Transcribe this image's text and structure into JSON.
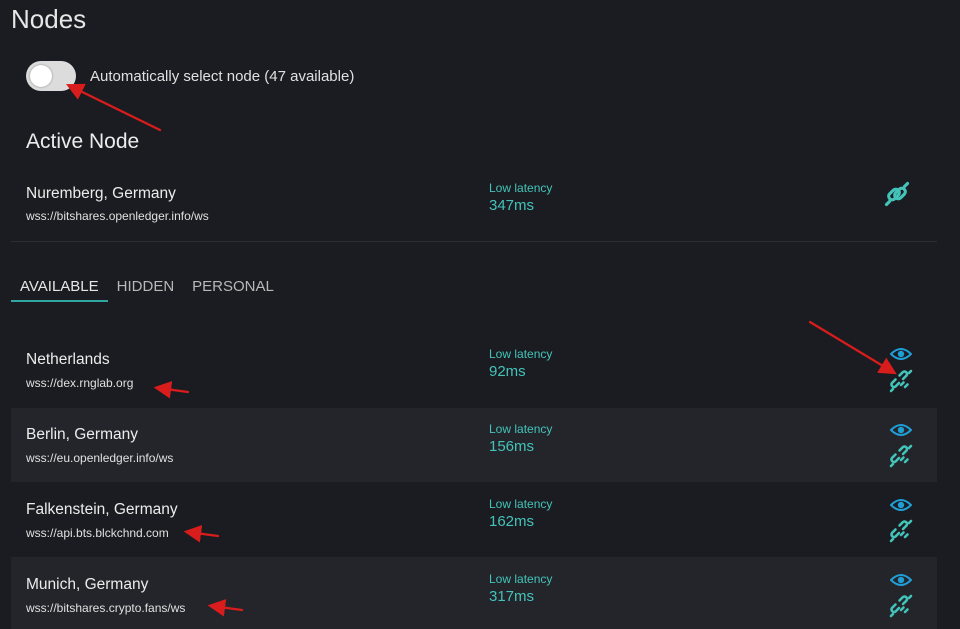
{
  "page": {
    "title": "Nodes"
  },
  "auto_select": {
    "label": "Automatically select node (47 available)",
    "enabled": false
  },
  "active_node": {
    "section_title": "Active Node",
    "name": "Nuremberg, Germany",
    "url": "wss://bitshares.openledger.info/ws",
    "latency_label": "Low latency",
    "latency_value": "347ms",
    "icon": "connected-link-icon"
  },
  "tabs": [
    {
      "label": "AVAILABLE",
      "active": true
    },
    {
      "label": "HIDDEN",
      "active": false
    },
    {
      "label": "PERSONAL",
      "active": false
    }
  ],
  "nodes": [
    {
      "name": "Netherlands",
      "url": "wss://dex.rnglab.org",
      "latency_label": "Low latency",
      "latency_value": "92ms"
    },
    {
      "name": "Berlin, Germany",
      "url": "wss://eu.openledger.info/ws",
      "latency_label": "Low latency",
      "latency_value": "156ms"
    },
    {
      "name": "Falkenstein, Germany",
      "url": "wss://api.bts.blckchnd.com",
      "latency_label": "Low latency",
      "latency_value": "162ms"
    },
    {
      "name": "Munich, Germany",
      "url": "wss://bitshares.crypto.fans/ws",
      "latency_label": "Low latency",
      "latency_value": "317ms"
    }
  ],
  "colors": {
    "accent": "#43c3b9",
    "eye": "#1f9fd6",
    "annotation_arrow": "#d91c1c"
  }
}
